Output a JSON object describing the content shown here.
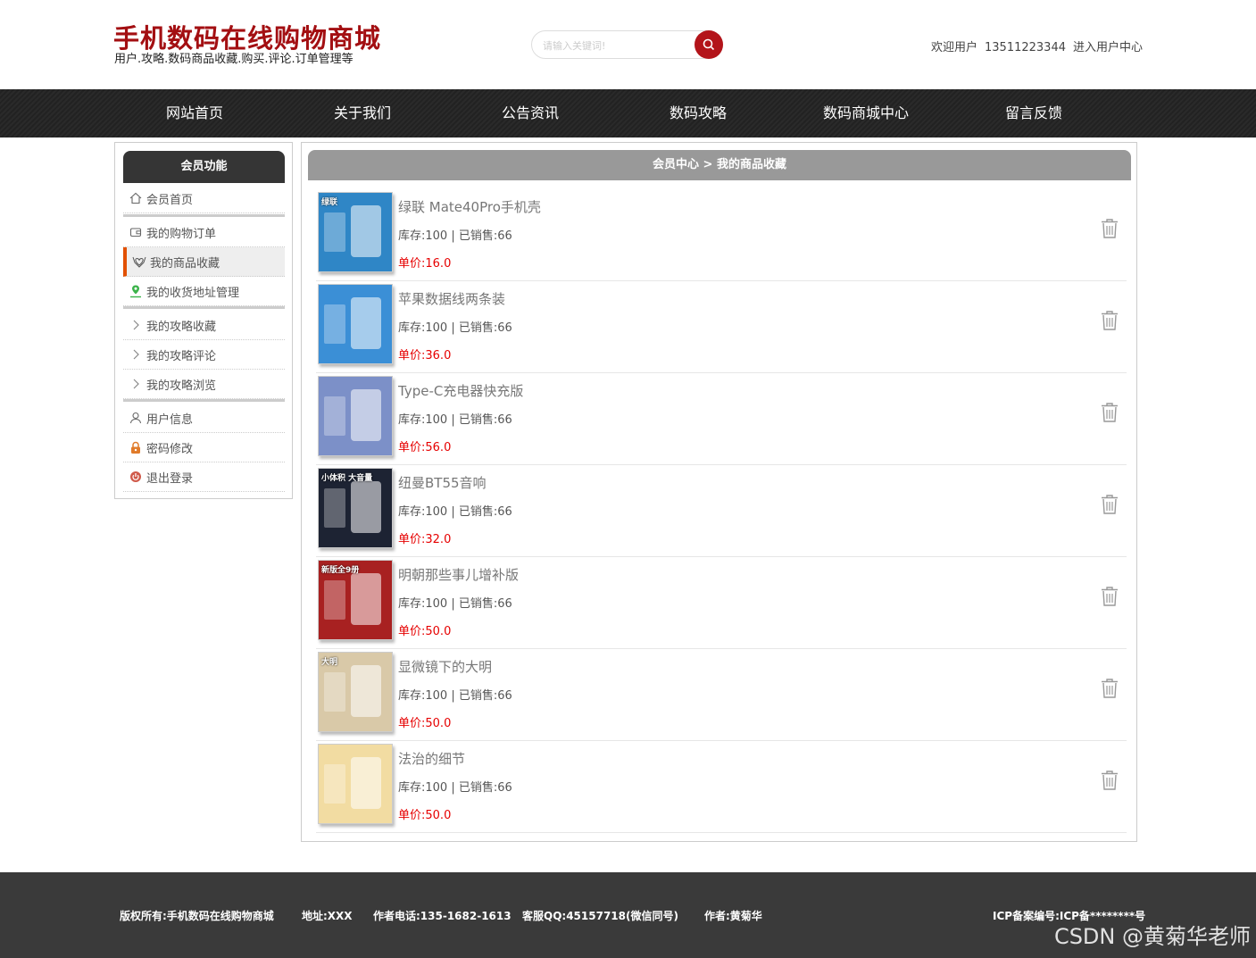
{
  "header": {
    "title": "手机数码在线购物商城",
    "subtitle": "用户.攻略.数码商品收藏.购买.评论.订单管理等",
    "search_placeholder": "请输入关键词!",
    "welcome_prefix": "欢迎用户",
    "username": "13511223344",
    "user_center_link": "进入用户中心",
    "accent_color": "#a30f12"
  },
  "nav": {
    "items": [
      "网站首页",
      "关于我们",
      "公告资讯",
      "数码攻略",
      "数码商城中心",
      "留言反馈"
    ]
  },
  "sidebar": {
    "heading": "会员功能",
    "items": [
      {
        "label": "会员首页",
        "icon": "home-icon"
      },
      {
        "label": "我的购物订单",
        "icon": "wallet-icon"
      },
      {
        "label": "我的商品收藏",
        "icon": "heart-hands-icon",
        "active": true
      },
      {
        "label": "我的收货地址管理",
        "icon": "location-pin-icon"
      },
      {
        "label": "我的攻略收藏",
        "icon": "chevron-right-icon"
      },
      {
        "label": "我的攻略评论",
        "icon": "chevron-right-icon"
      },
      {
        "label": "我的攻略浏览",
        "icon": "chevron-right-icon"
      },
      {
        "label": "用户信息",
        "icon": "user-icon"
      },
      {
        "label": "密码修改",
        "icon": "lock-icon"
      },
      {
        "label": "退出登录",
        "icon": "power-icon"
      }
    ]
  },
  "main": {
    "breadcrumb": "会员中心 > 我的商品收藏",
    "stock_label": "库存:",
    "sold_label": "已销售:",
    "price_label": "单价:",
    "products": [
      {
        "name": "绿联 Mate40Pro手机壳",
        "stock": "100",
        "sold": "66",
        "price": "16.0",
        "thumb_label": "绿联",
        "thumb_color": "#2f86c6"
      },
      {
        "name": "苹果数据线两条装",
        "stock": "100",
        "sold": "66",
        "price": "36.0",
        "thumb_label": "",
        "thumb_color": "#3b8fd6"
      },
      {
        "name": "Type-C充电器快充版",
        "stock": "100",
        "sold": "66",
        "price": "56.0",
        "thumb_label": "",
        "thumb_color": "#7c90c8"
      },
      {
        "name": "纽曼BT55音响",
        "stock": "100",
        "sold": "66",
        "price": "32.0",
        "thumb_label": "小体积 大音量",
        "thumb_color": "#1d2333"
      },
      {
        "name": "明朝那些事儿增补版",
        "stock": "100",
        "sold": "66",
        "price": "50.0",
        "thumb_label": "新版全9册",
        "thumb_color": "#a82121"
      },
      {
        "name": "显微镜下的大明",
        "stock": "100",
        "sold": "66",
        "price": "50.0",
        "thumb_label": "大明",
        "thumb_color": "#d9c9a8"
      },
      {
        "name": "法治的细节",
        "stock": "100",
        "sold": "66",
        "price": "50.0",
        "thumb_label": "",
        "thumb_color": "#f2dca2"
      }
    ]
  },
  "footer": {
    "copyright": "版权所有:手机数码在线购物商城",
    "address": "地址:XXX",
    "phone": "作者电话:135-1682-1613",
    "qq": "客服QQ:45157718(微信同号)",
    "author": "作者:黄菊华",
    "icp": "ICP备案编号:ICP备********号",
    "watermark": "CSDN @黄菊华老师"
  }
}
